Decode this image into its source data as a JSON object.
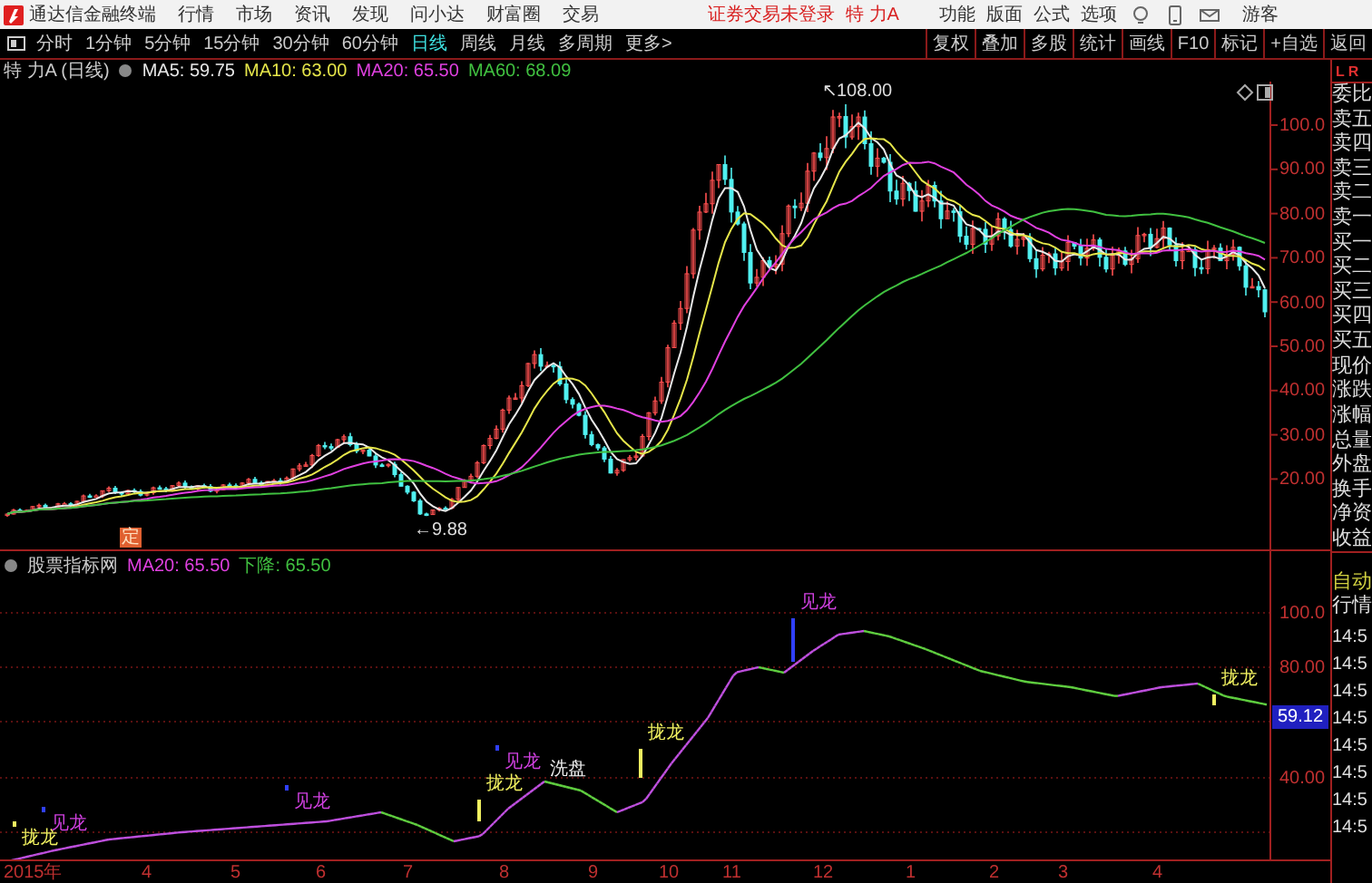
{
  "menubar": {
    "app_title": "通达信金融终端",
    "menus": [
      "行情",
      "市场",
      "资讯",
      "发现",
      "问小达",
      "财富圈",
      "交易"
    ],
    "login_status": "证券交易未登录",
    "stock_name": "特 力A",
    "actions": [
      "功能",
      "版面",
      "公式",
      "选项"
    ],
    "user": "游客"
  },
  "period_bar": {
    "periods": [
      {
        "label": "分时",
        "selected": false
      },
      {
        "label": "1分钟",
        "selected": false
      },
      {
        "label": "5分钟",
        "selected": false
      },
      {
        "label": "15分钟",
        "selected": false
      },
      {
        "label": "30分钟",
        "selected": false
      },
      {
        "label": "60分钟",
        "selected": false
      },
      {
        "label": "日线",
        "selected": true
      },
      {
        "label": "周线",
        "selected": false
      },
      {
        "label": "月线",
        "selected": false
      },
      {
        "label": "多周期",
        "selected": false
      },
      {
        "label": "更多>",
        "selected": false
      }
    ],
    "tools": [
      "复权",
      "叠加",
      "多股",
      "统计",
      "画线",
      "F10",
      "标记",
      "+自选",
      "返回"
    ]
  },
  "price_chart": {
    "title": "特 力A (日线)",
    "ma_legend": [
      {
        "label": "MA5: 59.75",
        "color": "#e8e8e8"
      },
      {
        "label": "MA10: 63.00",
        "color": "#e6e64a"
      },
      {
        "label": "MA20: 65.50",
        "color": "#e040e0"
      },
      {
        "label": "MA60: 68.09",
        "color": "#40c040"
      }
    ],
    "y_labels": [
      "100.0",
      "90.00",
      "80.00",
      "70.00",
      "60.00",
      "50.00",
      "40.00",
      "30.00",
      "20.00"
    ],
    "high_marker": "↖108.00",
    "low_marker": "←9.88",
    "event_marker": "定"
  },
  "indicator": {
    "name": "股票指标网",
    "legend": [
      {
        "label": "MA20: 65.50",
        "color": "#e040e0"
      },
      {
        "label": "下降: 65.50",
        "color": "#40c040"
      }
    ],
    "y_labels": [
      "100.0",
      "80.00",
      "40.00"
    ],
    "current_value": "59.12",
    "signals": [
      {
        "text": "拢龙",
        "kind": "gather"
      },
      {
        "text": "见龙",
        "kind": "see"
      },
      {
        "text": "见龙",
        "kind": "see"
      },
      {
        "text": "拢龙",
        "kind": "gather"
      },
      {
        "text": "见龙",
        "kind": "see"
      },
      {
        "text": "洗盘",
        "kind": "wash"
      },
      {
        "text": "拢龙",
        "kind": "gather"
      },
      {
        "text": "见龙",
        "kind": "see"
      },
      {
        "text": "拢龙",
        "kind": "gather"
      }
    ]
  },
  "x_axis": [
    "2015年",
    "4",
    "5",
    "6",
    "7",
    "8",
    "9",
    "10",
    "11",
    "12",
    "1",
    "2",
    "3",
    "4"
  ],
  "quote_panel": {
    "tabs": [
      "L",
      "R"
    ],
    "fields": [
      "委比",
      "卖五",
      "卖四",
      "卖三",
      "卖二",
      "卖一",
      "买一",
      "买二",
      "买三",
      "买四",
      "买五",
      "现价",
      "涨跌",
      "涨幅",
      "总量",
      "外盘",
      "换手",
      "净资",
      "收益"
    ],
    "auto_label": "自动",
    "ticks_label": "行情",
    "times": [
      "14:5",
      "14:5",
      "14:5",
      "14:5",
      "14:5",
      "14:5",
      "14:5",
      "14:5"
    ]
  }
}
